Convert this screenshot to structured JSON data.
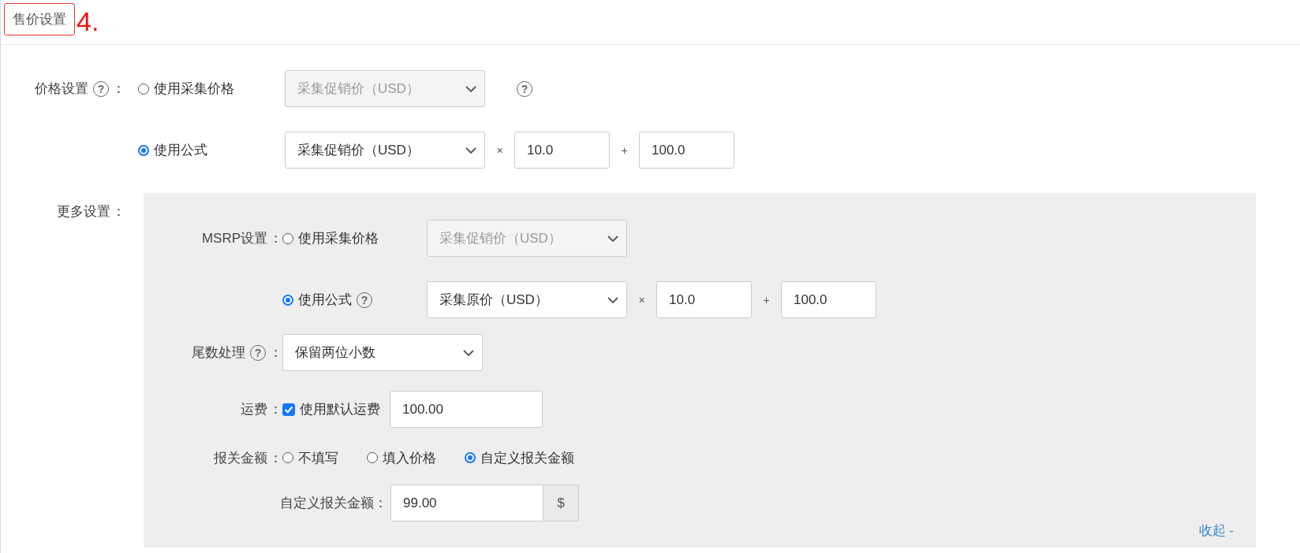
{
  "header": {
    "title": "售价设置",
    "annotation": "4."
  },
  "price": {
    "label": "价格设置",
    "help": "?",
    "colon": "：",
    "options": [
      {
        "label": "使用采集价格",
        "selected": false,
        "select": {
          "value": "采集促销价（USD）",
          "disabled": true
        },
        "trailing_help": "?"
      },
      {
        "label": "使用公式",
        "selected": true,
        "select": {
          "value": "采集促销价（USD）",
          "disabled": false
        },
        "ops": [
          {
            "sign": "×",
            "value": "10.0"
          },
          {
            "sign": "+",
            "value": "100.0"
          }
        ]
      }
    ]
  },
  "more": {
    "label": "更多设置",
    "colon": "：",
    "collapse": "收起 -",
    "rows": [
      {
        "kind": "choice",
        "label": "MSRP设置",
        "colon": "：",
        "options": [
          {
            "label": "使用采集价格",
            "selected": false,
            "select": {
              "value": "采集促销价（USD）",
              "disabled": true
            }
          },
          {
            "label": "使用公式",
            "selected": true,
            "help": "?",
            "select": {
              "value": "采集原价（USD）",
              "disabled": false
            },
            "ops": [
              {
                "sign": "×",
                "value": "10.0"
              },
              {
                "sign": "+",
                "value": "100.0"
              }
            ]
          }
        ]
      },
      {
        "kind": "select",
        "label": "尾数处理",
        "help": "?",
        "colon": "：",
        "select": {
          "value": "保留两位小数",
          "disabled": false
        }
      },
      {
        "kind": "checkbox",
        "label": "运费",
        "colon": "：",
        "checkbox": {
          "label": "使用默认运费",
          "checked": true
        },
        "input": {
          "value": "100.00"
        }
      },
      {
        "kind": "radios",
        "label": "报关金额",
        "colon": "：",
        "options": [
          {
            "label": "不填写",
            "selected": false
          },
          {
            "label": "填入价格",
            "selected": false
          },
          {
            "label": "自定义报关金额",
            "selected": true
          }
        ]
      },
      {
        "kind": "addon_input",
        "label": "自定义报关金额",
        "colon": "：",
        "input": {
          "value": "99.00"
        },
        "addon": "$"
      }
    ]
  }
}
